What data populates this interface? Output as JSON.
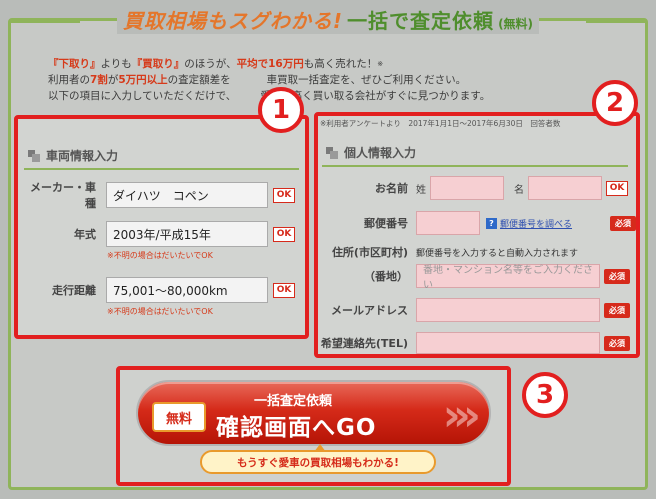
{
  "header": {
    "title_orange": "買取相場もスグわかる!",
    "title_green": "一括で査定依頼",
    "title_small": "(無料)"
  },
  "intro": {
    "line1_a": "『下取り』",
    "line1_b": "よりも",
    "line1_c": "『買取り』",
    "line1_d": "のほうが、",
    "line1_e": "平均で16万円",
    "line1_f": "も高く売れた！",
    "line1_sup": "※",
    "line2_a": "利用者の",
    "line2_b": "7割",
    "line2_c": "が",
    "line2_d": "5万円以上",
    "line2_e": "の査定額差を",
    "line2_f": "車買取一括査定を、ぜひご利用ください。",
    "line3": "以下の項目に入力していただくだけで、",
    "line3_b": "愛車を高く買い取る会社がすぐに見つかります。",
    "survey_note": "※利用者アンケートより　2017年1月1日〜2017年6月30日　回答者数"
  },
  "badges": [
    "1",
    "2",
    "3"
  ],
  "vehicle": {
    "section_title": "車両情報入力",
    "maker_label": "メーカー・車種",
    "maker_value": "ダイハツ　コペン",
    "year_label": "年式",
    "year_value": "2003年/平成15年",
    "year_note": "※不明の場合はだいたいでOK",
    "mileage_label": "走行距離",
    "mileage_value": "75,001〜80,000km",
    "mileage_note": "※不明の場合はだいたいでOK",
    "ok_label": "OK"
  },
  "personal": {
    "section_title": "個人情報入力",
    "name_label": "お名前",
    "last_name_label": "姓",
    "first_name_label": "名",
    "postal_label": "郵便番号",
    "postal_link": "郵便番号を調べる",
    "address_label": "住所(市区町村)",
    "address_note": "郵便番号を入力すると自動入力されます",
    "street_label": "（番地）",
    "street_placeholder": "番地・マンション名等をご入力ください",
    "email_label": "メールアドレス",
    "phone_label": "希望連絡先(TEL)",
    "ok_label": "OK",
    "required_label": "必須"
  },
  "cta": {
    "free_label": "無料",
    "sub_label": "一括査定依頼",
    "main_label": "確認画面へGO",
    "tip": "もうすぐ愛車の買取相場もわかる!"
  },
  "colors": {
    "accent_red": "#e21f1f",
    "green": "#8fb45a",
    "orange": "#e4762b"
  }
}
